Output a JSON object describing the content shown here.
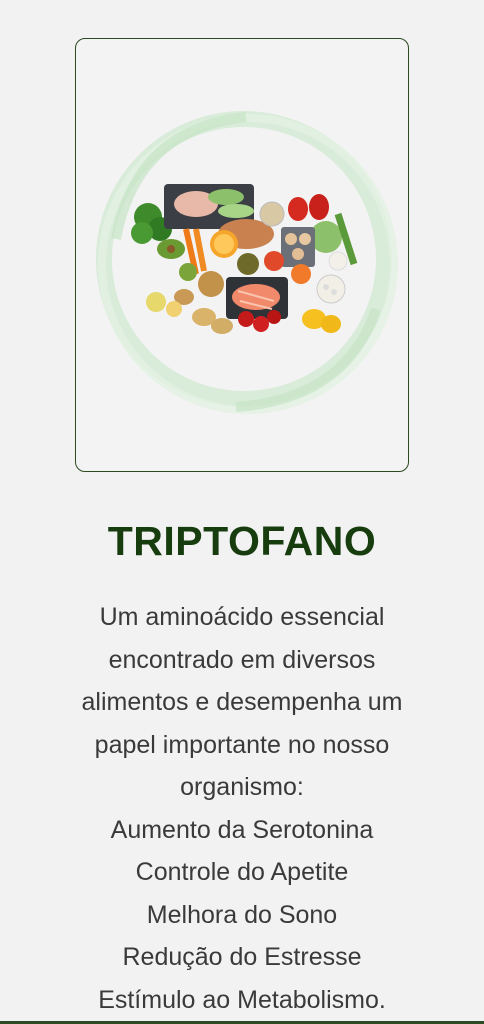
{
  "food_image": {
    "icon": "healthy-food-plate-illustration",
    "ring_color": "#cfe8cf"
  },
  "heading": {
    "title": "TRIPTOFANO",
    "color": "#173d0f"
  },
  "description": {
    "lines": [
      "Um aminoácido essencial",
      "encontrado em diversos",
      "alimentos e desempenha um",
      "papel importante no nosso",
      "organismo:"
    ],
    "benefits": [
      "Aumento da Serotonina",
      "Controle do Apetite",
      "Melhora do Sono",
      "Redução do Estresse",
      "Estímulo ao Metabolismo."
    ]
  },
  "accent_color": "#2d4a22"
}
